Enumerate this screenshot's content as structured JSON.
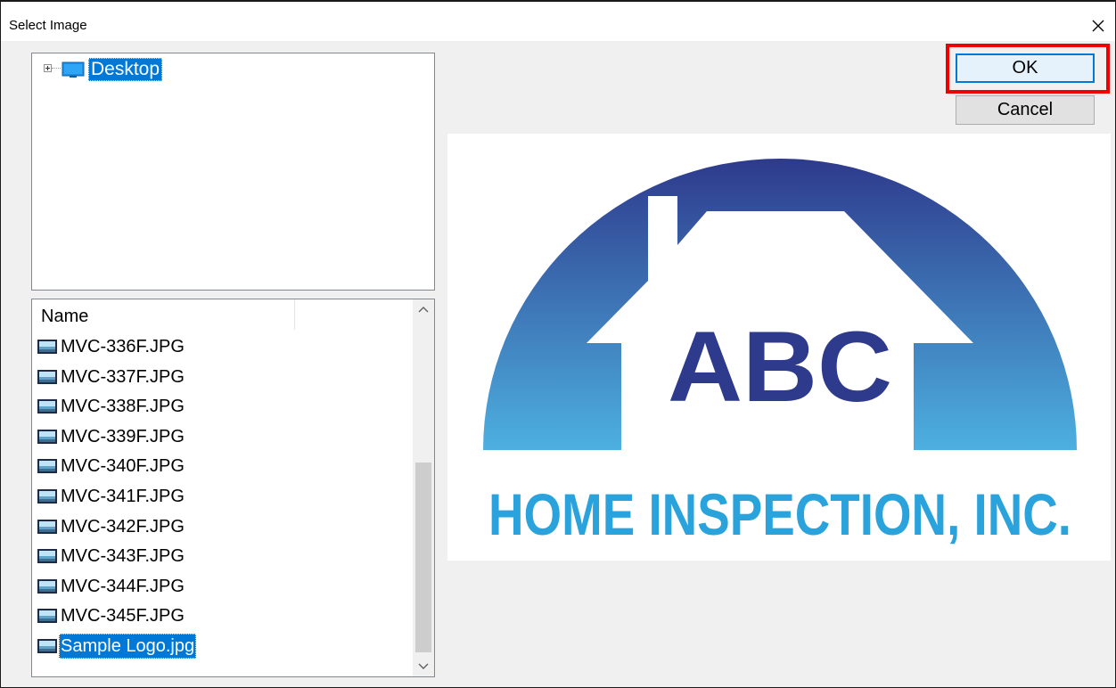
{
  "window": {
    "title": "Select Image"
  },
  "icons": {
    "close": "close-icon",
    "expander": "tree-expand-plus-icon",
    "desktop": "desktop-monitor-icon",
    "file": "image-file-icon",
    "scroll_up": "chevron-up-icon",
    "scroll_down": "chevron-down-icon"
  },
  "tree": {
    "root_label": "Desktop"
  },
  "file_list": {
    "column_header": "Name",
    "files": [
      {
        "name": "MVC-336F.JPG",
        "selected": false
      },
      {
        "name": "MVC-337F.JPG",
        "selected": false
      },
      {
        "name": "MVC-338F.JPG",
        "selected": false
      },
      {
        "name": "MVC-339F.JPG",
        "selected": false
      },
      {
        "name": "MVC-340F.JPG",
        "selected": false
      },
      {
        "name": "MVC-341F.JPG",
        "selected": false
      },
      {
        "name": "MVC-342F.JPG",
        "selected": false
      },
      {
        "name": "MVC-343F.JPG",
        "selected": false
      },
      {
        "name": "MVC-344F.JPG",
        "selected": false
      },
      {
        "name": "MVC-345F.JPG",
        "selected": false
      },
      {
        "name": "Sample Logo.jpg",
        "selected": true
      }
    ]
  },
  "buttons": {
    "ok_label": "OK",
    "cancel_label": "Cancel"
  },
  "preview": {
    "logo_main": "ABC",
    "logo_sub": "HOME INSPECTION, INC."
  },
  "colors": {
    "selection": "#0078d7",
    "highlight_box": "#ee0000",
    "logo_dark_blue": "#2e3a8c",
    "logo_light_blue": "#2aa3dc"
  }
}
